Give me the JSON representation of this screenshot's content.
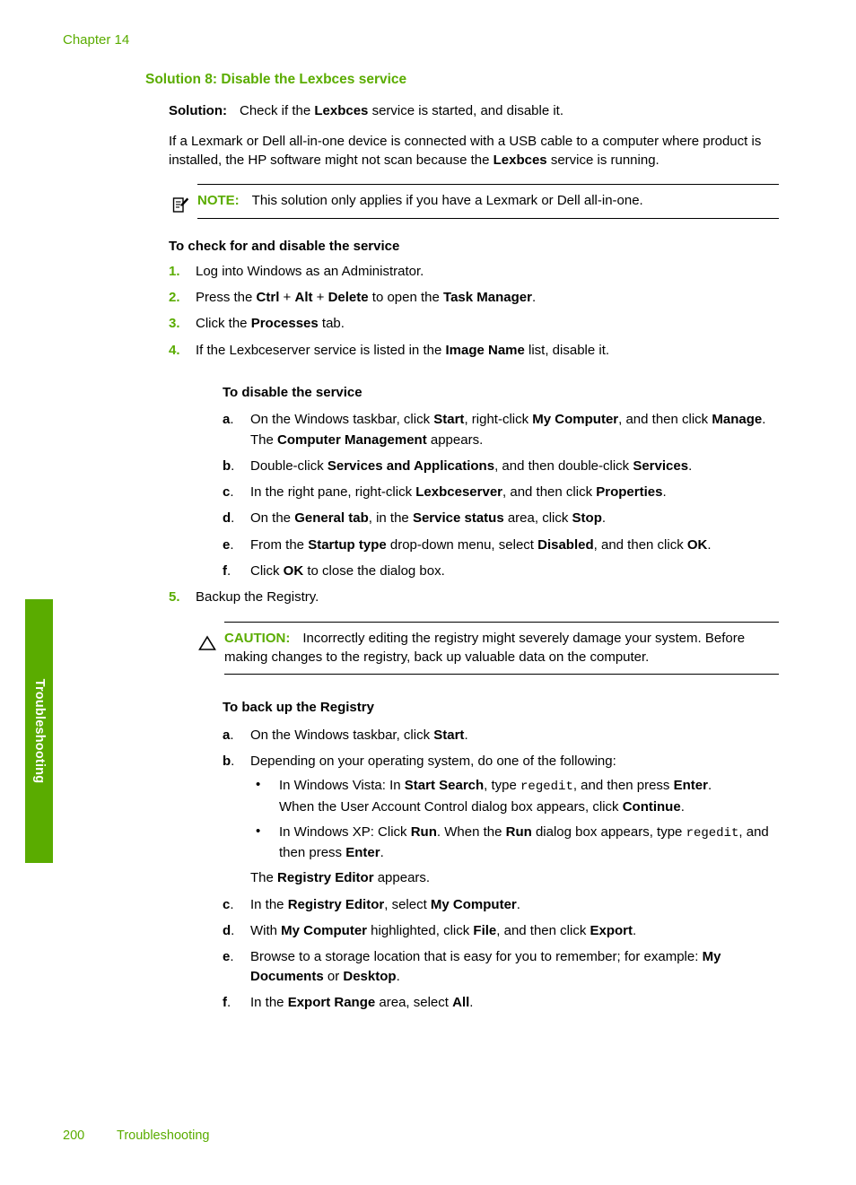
{
  "page": {
    "chapter_head": "Chapter 14",
    "side_tab_label": "Troubleshooting",
    "accent_color": "#5aac00",
    "footer": {
      "page_number": "200",
      "section": "Troubleshooting"
    }
  },
  "heading": "Solution 8: Disable the Lexbces service",
  "solution": {
    "label": "Solution:",
    "text_1": "Check if the ",
    "bold_1": "Lexbces",
    "text_2": " service is started, and disable it."
  },
  "intro": {
    "t1": "If a Lexmark or Dell all-in-one device is connected with a USB cable to a computer where product is installed, the HP software might not scan because the ",
    "b1": "Lexbces",
    "t2": " service is running."
  },
  "note": {
    "icon": "note-pencil-icon",
    "label": "NOTE:",
    "text": "This solution only applies if you have a Lexmark or Dell all-in-one."
  },
  "caution": {
    "icon": "warning-triangle-icon",
    "label": "CAUTION:",
    "text": "Incorrectly editing the registry might severely damage your system. Before making changes to the registry, back up valuable data on the computer."
  },
  "procedure_check": {
    "title": "To check for and disable the service",
    "steps": [
      {
        "marker": "1.",
        "t1": "Log into Windows as an Administrator."
      },
      {
        "marker": "2.",
        "t1": "Press the ",
        "b1": "Ctrl",
        "t2": " + ",
        "b2": "Alt",
        "t3": " + ",
        "b3": "Delete",
        "t4": " to open the ",
        "b4": "Task Manager",
        "t5": "."
      },
      {
        "marker": "3.",
        "t1": "Click the ",
        "b1": "Processes",
        "t2": " tab."
      },
      {
        "marker": "4.",
        "t1": "If the Lexbceserver service is listed in the ",
        "b1": "Image Name",
        "t2": " list, disable it."
      },
      {
        "marker": "5.",
        "t1": "Backup the Registry."
      }
    ]
  },
  "procedure_disable": {
    "title": "To disable the service",
    "steps": [
      {
        "marker": "a",
        "t1": "On the Windows taskbar, click ",
        "b1": "Start",
        "t2": ", right-click ",
        "b2": "My Computer",
        "t3": ", and then click ",
        "b3": "Manage",
        "t4": ".",
        "cont_t1": "The ",
        "cont_b1": "Computer Management",
        "cont_t2": " appears."
      },
      {
        "marker": "b",
        "t1": "Double-click ",
        "b1": "Services and Applications",
        "t2": ", and then double-click ",
        "b2": "Services",
        "t3": "."
      },
      {
        "marker": "c",
        "t1": "In the right pane, right-click ",
        "b1": "Lexbceserver",
        "t2": ", and then click ",
        "b2": "Properties",
        "t3": "."
      },
      {
        "marker": "d",
        "t1": "On the ",
        "b1": "General tab",
        "t2": ", in the ",
        "b2": "Service status",
        "t3": " area, click ",
        "b3": "Stop",
        "t4": "."
      },
      {
        "marker": "e",
        "t1": "From the ",
        "b1": "Startup type",
        "t2": " drop-down menu, select ",
        "b2": "Disabled",
        "t3": ", and then click ",
        "b3": "OK",
        "t4": "."
      },
      {
        "marker": "f",
        "t1": "Click ",
        "b1": "OK",
        "t2": " to close the dialog box."
      }
    ]
  },
  "procedure_backup": {
    "title": "To back up the Registry",
    "step_a": {
      "marker": "a",
      "t1": "On the Windows taskbar, click ",
      "b1": "Start",
      "t2": "."
    },
    "step_b": {
      "marker": "b",
      "t1": "Depending on your operating system, do one of the following:",
      "bullets": [
        {
          "marker": "•",
          "t1": "In Windows Vista: In ",
          "b1": "Start Search",
          "t2": ", type ",
          "mono1": "regedit",
          "t3": ", and then press ",
          "b2": "Enter",
          "t4": ".",
          "cont_t1": "When the User Account Control dialog box appears, click ",
          "cont_b1": "Continue",
          "cont_t2": "."
        },
        {
          "marker": "•",
          "t1": "In Windows XP: Click ",
          "b1": "Run",
          "t2": ". When the ",
          "b2": "Run",
          "t3": " dialog box appears, type ",
          "mono1": "regedit",
          "t4": ", and then press ",
          "b3": "Enter",
          "t5": "."
        }
      ],
      "cont_t1": "The ",
      "cont_b1": "Registry Editor",
      "cont_t2": " appears."
    },
    "steps_rest": [
      {
        "marker": "c",
        "t1": "In the ",
        "b1": "Registry Editor",
        "t2": ", select ",
        "b2": "My Computer",
        "t3": "."
      },
      {
        "marker": "d",
        "t1": "With ",
        "b1": "My Computer",
        "t2": " highlighted, click ",
        "b2": "File",
        "t3": ", and then click ",
        "b3": "Export",
        "t4": "."
      },
      {
        "marker": "e",
        "t1": "Browse to a storage location that is easy for you to remember; for example: ",
        "b1": "My Documents",
        "t2": " or ",
        "b2": "Desktop",
        "t3": "."
      },
      {
        "marker": "f",
        "t1": "In the ",
        "b1": "Export Range",
        "t2": " area, select ",
        "b2": "All",
        "t3": "."
      }
    ]
  }
}
